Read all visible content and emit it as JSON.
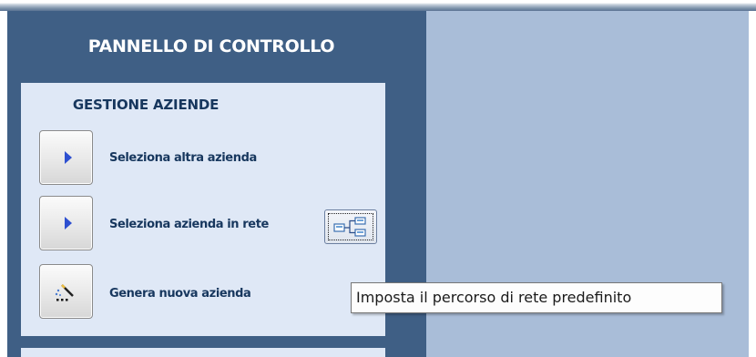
{
  "panel": {
    "title": "PANNELLO DI CONTROLLO",
    "section": {
      "title": "GESTIONE AZIENDE",
      "items": [
        {
          "label": "Seleziona altra azienda",
          "icon": "play-arrow-icon"
        },
        {
          "label": "Seleziona azienda in rete",
          "icon": "play-arrow-icon"
        },
        {
          "label": "Genera nuova azienda",
          "icon": "magic-wand-icon"
        }
      ]
    },
    "network_button": {
      "icon": "network-path-icon"
    }
  },
  "tooltip": {
    "text": "Imposta il percorso di rete predefinito"
  },
  "colors": {
    "panel_background": "#3f5f85",
    "section_background": "#dfe8f6",
    "workspace_background": "#a9bdd8",
    "label_color": "#17375e",
    "arrow_color": "#2d4fd0"
  }
}
